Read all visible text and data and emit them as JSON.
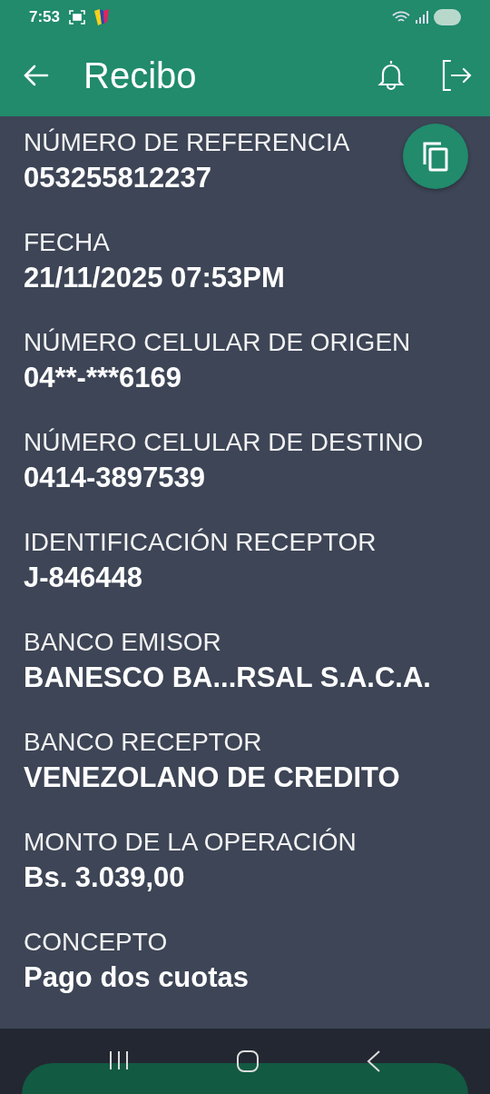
{
  "status_bar": {
    "time": "7:53"
  },
  "app_bar": {
    "title": "Recibo"
  },
  "fields": [
    {
      "label": "NÚMERO DE REFERENCIA",
      "value": "053255812237"
    },
    {
      "label": "FECHA",
      "value": "21/11/2025 07:53PM"
    },
    {
      "label": "NÚMERO CELULAR DE ORIGEN",
      "value": "04**-***6169"
    },
    {
      "label": "NÚMERO CELULAR DE DESTINO",
      "value": "0414-3897539"
    },
    {
      "label": "IDENTIFICACIÓN RECEPTOR",
      "value": "J-846448"
    },
    {
      "label": "BANCO EMISOR",
      "value": "BANESCO BA...RSAL S.A.C.A."
    },
    {
      "label": "BANCO RECEPTOR",
      "value": "VENEZOLANO DE CREDITO"
    },
    {
      "label": "MONTO DE LA OPERACIÓN",
      "value": "Bs. 3.039,00"
    },
    {
      "label": "CONCEPTO",
      "value": "Pago dos cuotas"
    }
  ]
}
